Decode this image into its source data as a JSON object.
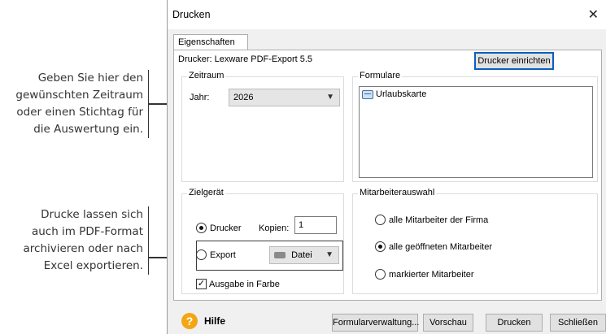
{
  "annotations": {
    "period": [
      "Geben Sie hier den",
      "gewünschten Zeitraum",
      "oder einen Stichtag für",
      "die Auswertung ein."
    ],
    "export": [
      "Drucke lassen sich",
      "auch im PDF-Format",
      "archivieren oder nach",
      "Excel exportieren."
    ]
  },
  "window": {
    "title": "Drucken",
    "close_icon": "close-icon"
  },
  "tabs": [
    {
      "label": "Eigenschaften"
    }
  ],
  "printer": {
    "label": "Drucker: Lexware PDF-Export 5.5",
    "setup_button": "Drucker einrichten"
  },
  "zeitraum": {
    "title": "Zeitraum",
    "year_label": "Jahr:",
    "year_value": "2026"
  },
  "formulare": {
    "title": "Formulare",
    "items": [
      "Urlaubskarte"
    ]
  },
  "zielgeraet": {
    "title": "Zielgerät",
    "drucker_label": "Drucker",
    "drucker_selected": true,
    "kopien_label": "Kopien:",
    "kopien_value": "1",
    "export_label": "Export",
    "export_selected": false,
    "export_target": "Datei",
    "color_label": "Ausgabe in Farbe",
    "color_checked": true
  },
  "mitarbeiter": {
    "title": "Mitarbeiterauswahl",
    "options": [
      "alle Mitarbeiter der Firma",
      "alle geöffneten Mitarbeiter",
      "markierter Mitarbeiter"
    ],
    "selected_index": 1
  },
  "footer": {
    "help_label": "Hilfe",
    "buttons": [
      "Formularverwaltung...",
      "Vorschau",
      "Drucken",
      "Schließen"
    ]
  },
  "colors": {
    "accent": "#0b5fbf",
    "help_icon": "#f3a614"
  }
}
